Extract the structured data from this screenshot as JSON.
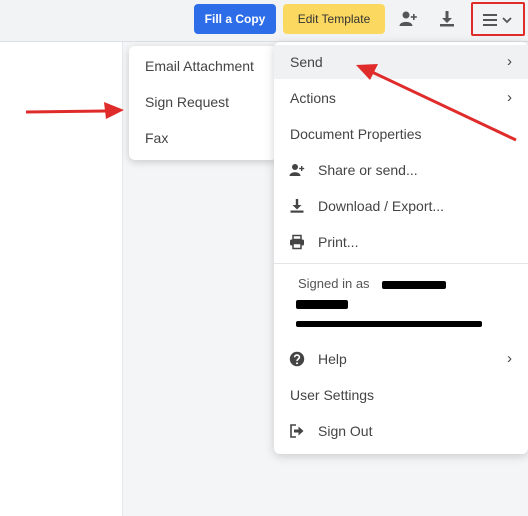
{
  "toolbar": {
    "fill_copy_label": "Fill a Copy",
    "edit_template_label": "Edit Template",
    "icons": [
      "add-user-icon",
      "download-icon",
      "menu-icon",
      "chevron-down-icon"
    ]
  },
  "send_submenu": {
    "items": [
      "Email Attachment",
      "Sign Request",
      "Fax"
    ]
  },
  "main_menu": {
    "send": "Send",
    "actions": "Actions",
    "document_properties": "Document Properties",
    "share": "Share or send...",
    "download": "Download / Export...",
    "print": "Print...",
    "signed_in_as": "Signed in as",
    "help": "Help",
    "user_settings": "User Settings",
    "sign_out": "Sign Out",
    "chevron": "›"
  },
  "colors": {
    "primary": "#2d6ee8",
    "accent_yellow": "#fbd860",
    "annotation_red": "#e02b2b"
  }
}
